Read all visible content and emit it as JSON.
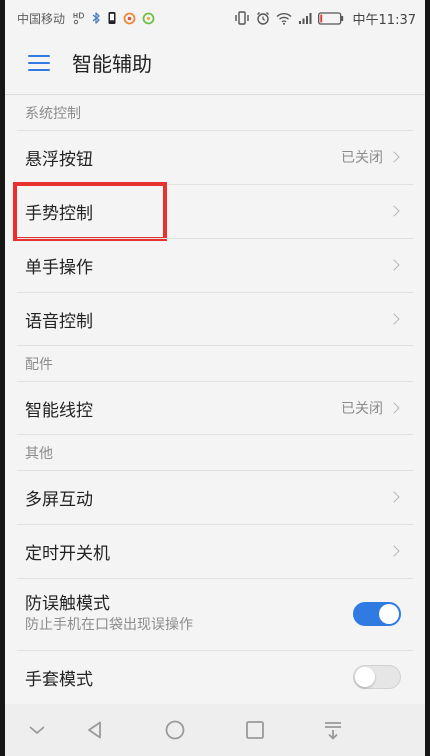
{
  "status_bar": {
    "carrier": "中国移动",
    "time": "中午11:37",
    "left_icons": [
      "hd-icon",
      "bluetooth-icon",
      "phone-notification-icon",
      "orange-app-notification-icon",
      "green-app-notification-icon"
    ],
    "right_icons": [
      "vibrate-icon",
      "alarm-icon",
      "wifi-icon",
      "signal-icon",
      "battery-icon"
    ],
    "battery_level": 0.1
  },
  "app_bar": {
    "menu_icon": "menu-icon",
    "title": "智能辅助"
  },
  "sections": [
    {
      "header": "系统控制",
      "items": [
        {
          "label": "悬浮按钮",
          "value": "已关闭",
          "trailing": "chevron-right-icon"
        },
        {
          "label": "手势控制",
          "trailing": "chevron-right-icon",
          "highlighted": true
        },
        {
          "label": "单手操作",
          "trailing": "chevron-right-icon"
        },
        {
          "label": "语音控制",
          "trailing": "chevron-right-icon"
        }
      ]
    },
    {
      "header": "配件",
      "items": [
        {
          "label": "智能线控",
          "value": "已关闭",
          "trailing": "chevron-right-icon"
        }
      ]
    },
    {
      "header": "其他",
      "items": [
        {
          "label": "多屏互动",
          "trailing": "chevron-right-icon"
        },
        {
          "label": "定时开关机",
          "trailing": "chevron-right-icon"
        },
        {
          "label": "防误触模式",
          "subtitle": "防止手机在口袋出现误操作",
          "toggle_on": true
        },
        {
          "label": "手套模式",
          "toggle_on": false
        }
      ]
    }
  ],
  "nav_bar": {
    "buttons": [
      "collapse-icon",
      "back-icon",
      "home-icon",
      "recents-icon",
      "notification-pull-icon"
    ]
  },
  "colors": {
    "accent": "#2f7be2",
    "highlight": "#e8302f",
    "background": "#f4f4f4",
    "text_primary": "#222222",
    "text_secondary": "#8c8c8c",
    "battery_low": "#e53935"
  }
}
